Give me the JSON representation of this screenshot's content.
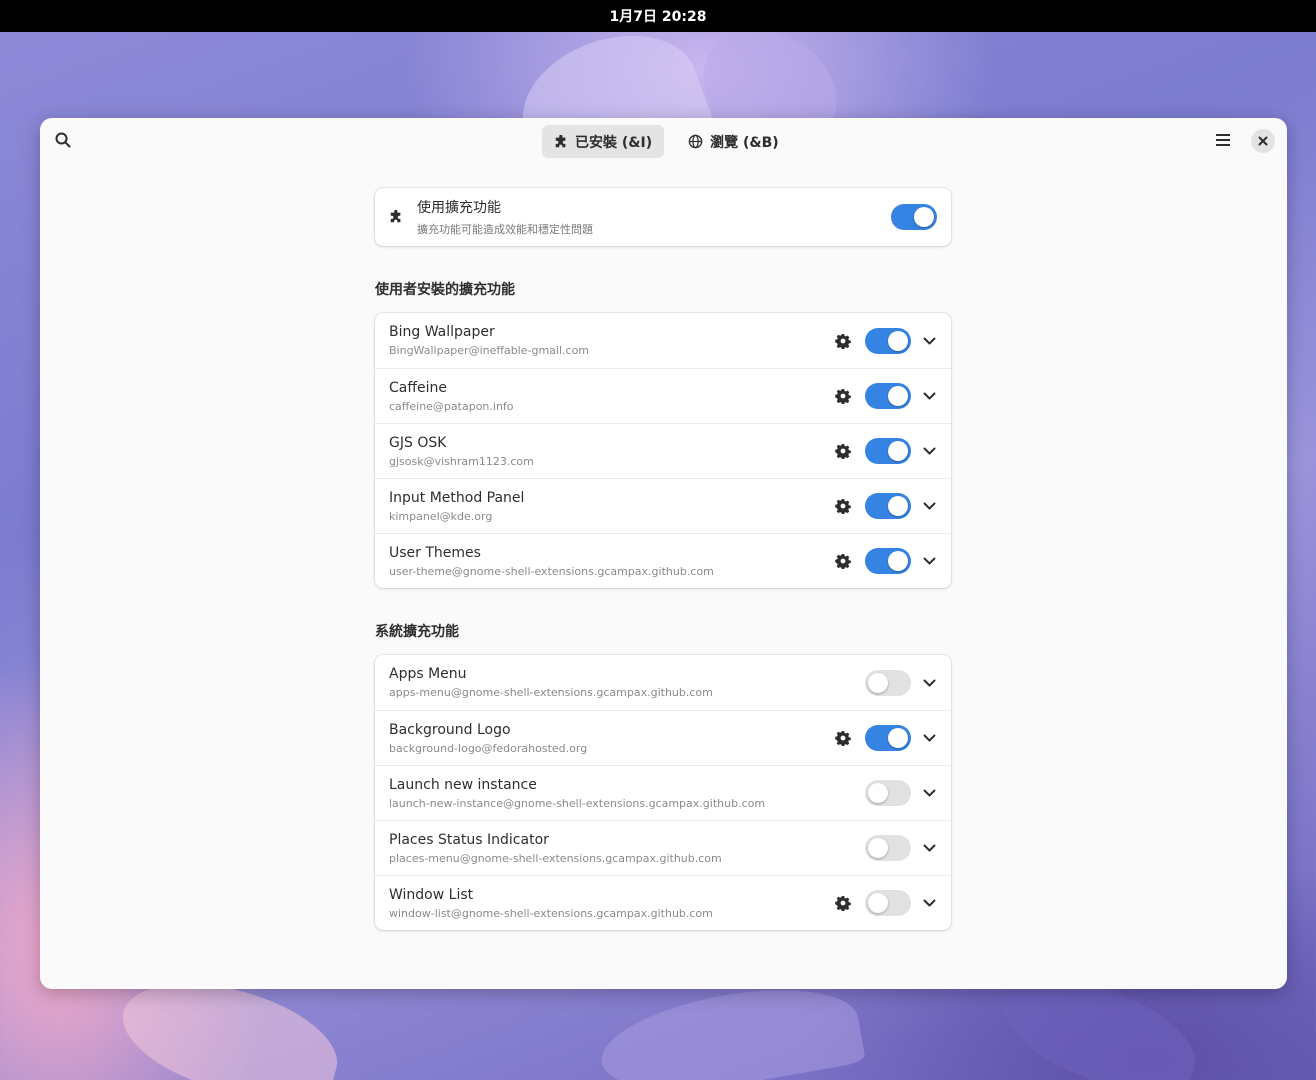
{
  "topbar": {
    "clock": "1月7日 20:28"
  },
  "header": {
    "tabs": [
      {
        "label": "已安裝 (&I)",
        "icon": "puzzle-icon",
        "active": true
      },
      {
        "label": "瀏覽 (&B)",
        "icon": "globe-icon",
        "active": false
      }
    ]
  },
  "main_toggle": {
    "title": "使用擴充功能",
    "subtitle": "擴充功能可能造成效能和穩定性問題",
    "enabled": true
  },
  "user_section": {
    "title": "使用者安裝的擴充功能",
    "items": [
      {
        "name": "Bing Wallpaper",
        "uuid": "BingWallpaper@ineffable-gmail.com",
        "enabled": true,
        "has_settings": true
      },
      {
        "name": "Caffeine",
        "uuid": "caffeine@patapon.info",
        "enabled": true,
        "has_settings": true
      },
      {
        "name": "GJS OSK",
        "uuid": "gjsosk@vishram1123.com",
        "enabled": true,
        "has_settings": true
      },
      {
        "name": "Input Method Panel",
        "uuid": "kimpanel@kde.org",
        "enabled": true,
        "has_settings": true
      },
      {
        "name": "User Themes",
        "uuid": "user-theme@gnome-shell-extensions.gcampax.github.com",
        "enabled": true,
        "has_settings": true
      }
    ]
  },
  "system_section": {
    "title": "系統擴充功能",
    "items": [
      {
        "name": "Apps Menu",
        "uuid": "apps-menu@gnome-shell-extensions.gcampax.github.com",
        "enabled": false,
        "has_settings": false
      },
      {
        "name": "Background Logo",
        "uuid": "background-logo@fedorahosted.org",
        "enabled": true,
        "has_settings": true
      },
      {
        "name": "Launch new instance",
        "uuid": "launch-new-instance@gnome-shell-extensions.gcampax.github.com",
        "enabled": false,
        "has_settings": false
      },
      {
        "name": "Places Status Indicator",
        "uuid": "places-menu@gnome-shell-extensions.gcampax.github.com",
        "enabled": false,
        "has_settings": false
      },
      {
        "name": "Window List",
        "uuid": "window-list@gnome-shell-extensions.gcampax.github.com",
        "enabled": false,
        "has_settings": true
      }
    ]
  },
  "colors": {
    "accent": "#3584e4",
    "switch_off": "#e1e1e1"
  }
}
